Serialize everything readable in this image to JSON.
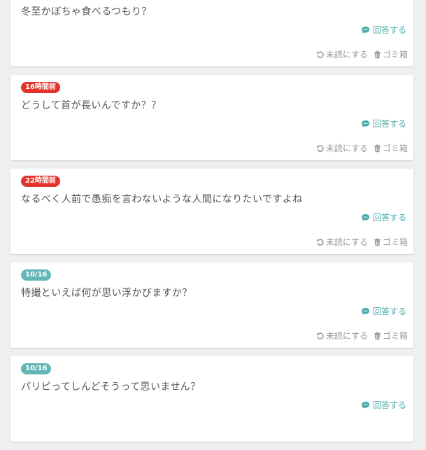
{
  "labels": {
    "answer": "回答する",
    "mark_unread": "未読にする",
    "trash": "ゴミ箱"
  },
  "colors": {
    "badge_recent": "#e2342c",
    "badge_date": "#63b7b6",
    "answer_link": "#4aa8a8",
    "action_text": "#999999"
  },
  "questions": [
    {
      "badge": "",
      "badge_style": "none",
      "text": "冬至かぼちゃ食べるつもり？"
    },
    {
      "badge": "16時間前",
      "badge_style": "red",
      "text": "どうして首が長いんですか？？"
    },
    {
      "badge": "22時間前",
      "badge_style": "red",
      "text": "なるべく人前で愚痴を言わないような人間になりたいですよね"
    },
    {
      "badge": "10/16",
      "badge_style": "teal",
      "text": "特撮といえば何が思い浮かびますか？"
    },
    {
      "badge": "10/16",
      "badge_style": "teal",
      "text": "パリピってしんどそうって思いません？"
    }
  ]
}
